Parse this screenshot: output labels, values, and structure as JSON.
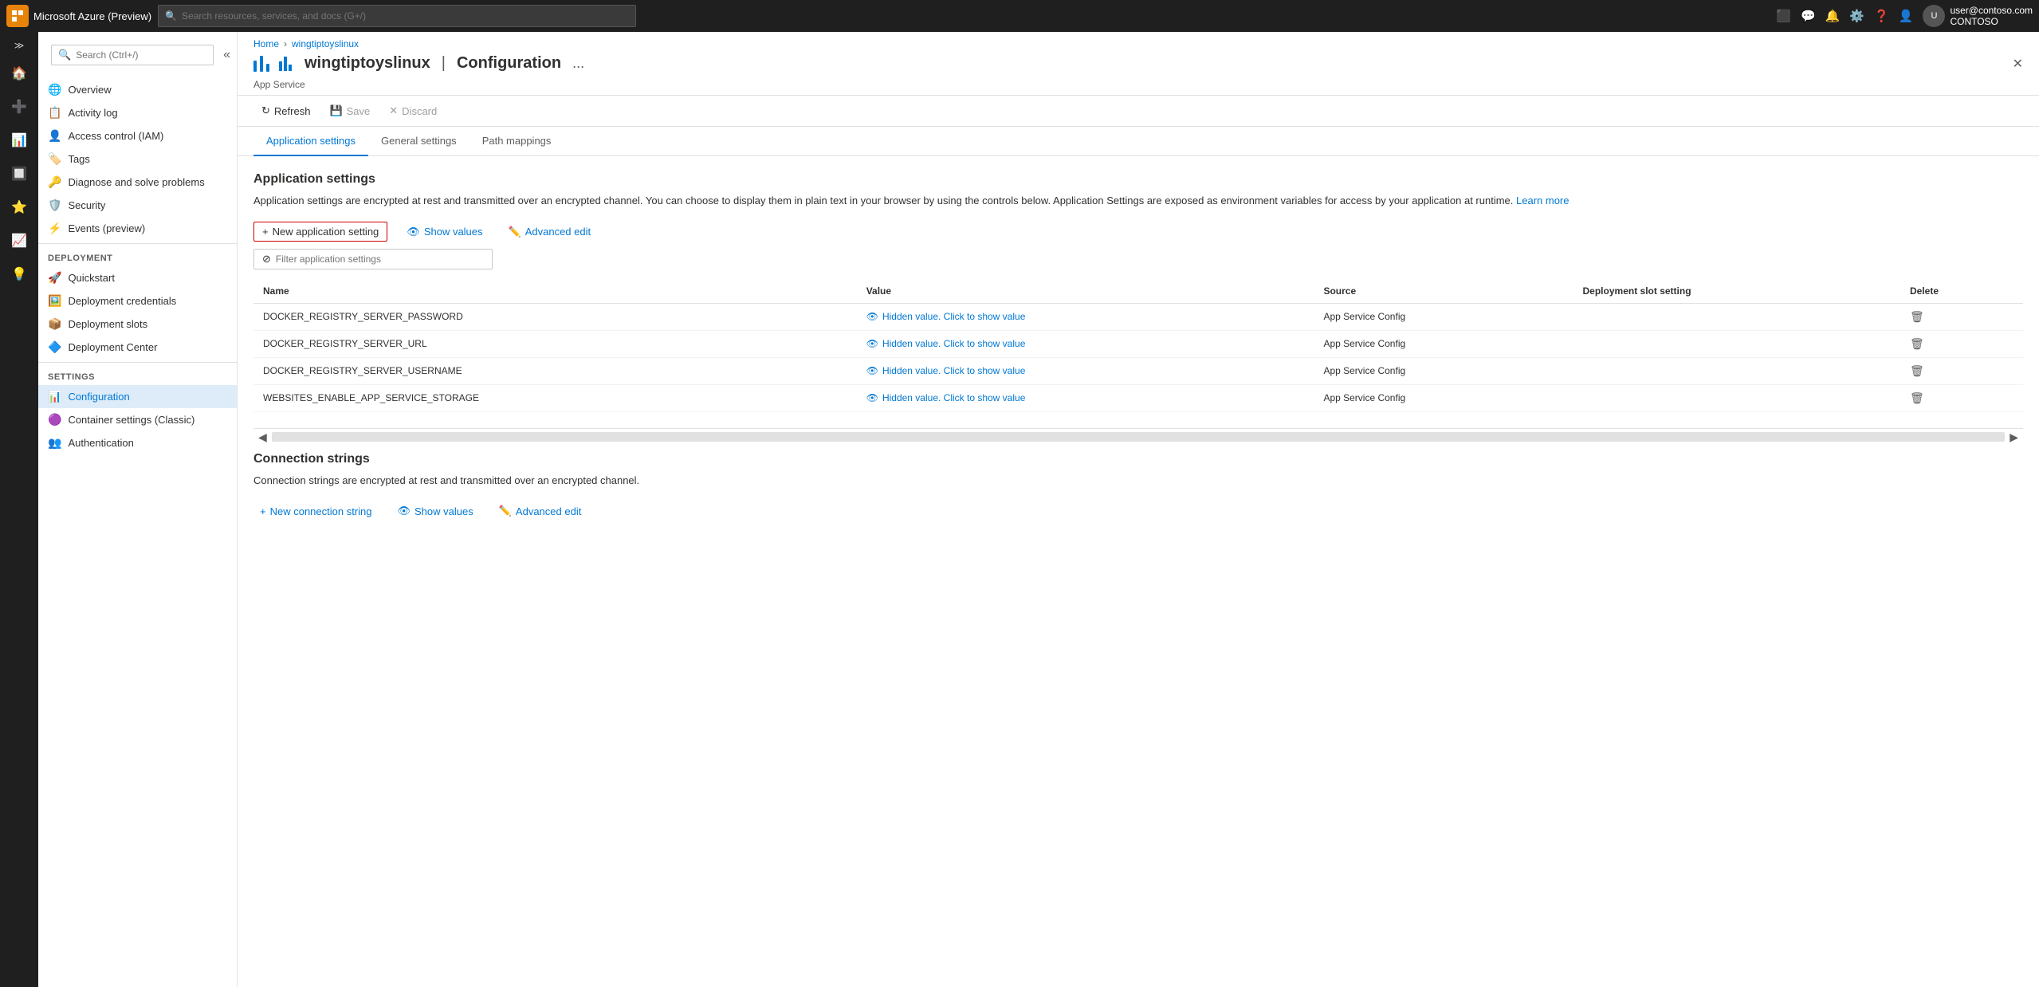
{
  "topbar": {
    "brand": "Microsoft Azure (Preview)",
    "search_placeholder": "Search resources, services, and docs (G+/)",
    "user_email": "user@contoso.com",
    "user_tenant": "CONTOSO"
  },
  "breadcrumb": {
    "home": "Home",
    "resource": "wingtiptoyslinux"
  },
  "page": {
    "icon_label": "App Service bars",
    "title": "wingtiptoyslinux",
    "subtitle": "App Service",
    "separator": "|",
    "section": "Configuration",
    "more_label": "...",
    "close_label": "✕"
  },
  "sidebar": {
    "search_placeholder": "Search (Ctrl+/)",
    "items": [
      {
        "id": "overview",
        "label": "Overview",
        "icon": "🌐"
      },
      {
        "id": "activity-log",
        "label": "Activity log",
        "icon": "📋"
      },
      {
        "id": "access-control",
        "label": "Access control (IAM)",
        "icon": "👤"
      },
      {
        "id": "tags",
        "label": "Tags",
        "icon": "🏷️"
      },
      {
        "id": "diagnose",
        "label": "Diagnose and solve problems",
        "icon": "🔑"
      },
      {
        "id": "security",
        "label": "Security",
        "icon": "🛡️"
      },
      {
        "id": "events",
        "label": "Events (preview)",
        "icon": "⚡"
      }
    ],
    "deployment_header": "Deployment",
    "deployment_items": [
      {
        "id": "quickstart",
        "label": "Quickstart",
        "icon": "🚀"
      },
      {
        "id": "deployment-credentials",
        "label": "Deployment credentials",
        "icon": "🖼️"
      },
      {
        "id": "deployment-slots",
        "label": "Deployment slots",
        "icon": "📦"
      },
      {
        "id": "deployment-center",
        "label": "Deployment Center",
        "icon": "🔷"
      }
    ],
    "settings_header": "Settings",
    "settings_items": [
      {
        "id": "configuration",
        "label": "Configuration",
        "icon": "📊",
        "active": true
      },
      {
        "id": "container-settings",
        "label": "Container settings (Classic)",
        "icon": "🟣"
      },
      {
        "id": "authentication",
        "label": "Authentication",
        "icon": "👥"
      }
    ]
  },
  "toolbar": {
    "refresh_label": "Refresh",
    "save_label": "Save",
    "discard_label": "Discard"
  },
  "tabs": [
    {
      "id": "application-settings",
      "label": "Application settings",
      "active": true
    },
    {
      "id": "general-settings",
      "label": "General settings"
    },
    {
      "id": "path-mappings",
      "label": "Path mappings"
    }
  ],
  "app_settings": {
    "title": "Application settings",
    "description": "Application settings are encrypted at rest and transmitted over an encrypted channel. You can choose to display them in plain text in your browser by using the controls below. Application Settings are exposed as environment variables for access by your application at runtime.",
    "learn_more": "Learn more",
    "new_setting_label": "+ New application setting",
    "show_values_label": "Show values",
    "advanced_edit_label": "Advanced edit",
    "filter_placeholder": "Filter application settings",
    "columns": [
      "Name",
      "Value",
      "Source",
      "Deployment slot setting",
      "Delete"
    ],
    "rows": [
      {
        "name": "DOCKER_REGISTRY_SERVER_PASSWORD",
        "value": "Hidden value. Click to show value",
        "source": "App Service Config",
        "slot": ""
      },
      {
        "name": "DOCKER_REGISTRY_SERVER_URL",
        "value": "Hidden value. Click to show value",
        "source": "App Service Config",
        "slot": ""
      },
      {
        "name": "DOCKER_REGISTRY_SERVER_USERNAME",
        "value": "Hidden value. Click to show value",
        "source": "App Service Config",
        "slot": ""
      },
      {
        "name": "WEBSITES_ENABLE_APP_SERVICE_STORAGE",
        "value": "Hidden value. Click to show value",
        "source": "App Service Config",
        "slot": ""
      }
    ]
  },
  "connection_strings": {
    "title": "Connection strings",
    "description": "Connection strings are encrypted at rest and transmitted over an encrypted channel.",
    "new_connection_label": "+ New connection string",
    "show_values_label": "Show values",
    "advanced_edit_label": "Advanced edit"
  },
  "icons": {
    "search": "🔍",
    "refresh": "↻",
    "save": "💾",
    "discard": "✕",
    "eye": "👁",
    "pencil": "✏️",
    "filter": "⊘",
    "delete": "🗑",
    "plus": "+"
  }
}
